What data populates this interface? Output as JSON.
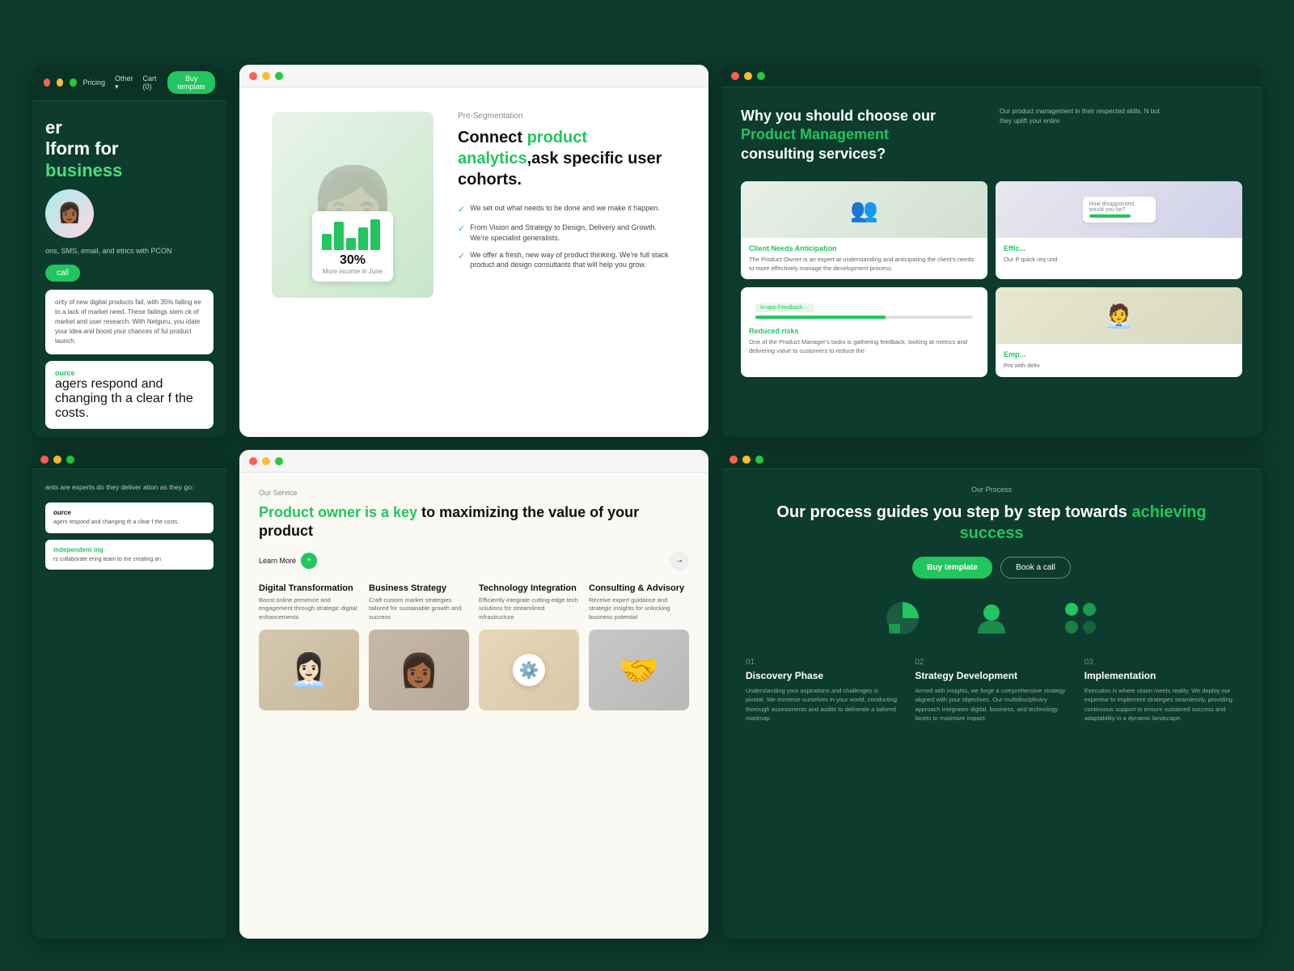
{
  "background": "#0d3b2e",
  "nav": {
    "pricing": "Pricing",
    "other": "Other",
    "other_arrow": "▾",
    "cart": "Cart (0)",
    "buy_btn": "Buy template"
  },
  "topleft": {
    "hero_line1": "er",
    "hero_line2": "lform for",
    "hero_green": "business",
    "sub_text": "ons, SMS, email, and\netrics with PCON",
    "call_btn": "call",
    "stat_text1": "ority of new digital products fail, with 35% falling\nee to a lack of market need. These failings stem\nck of market and user research. With Netguru, you\nidate your idea and boost your chances of\nful product launch.",
    "green_link1": "ource",
    "green_link2": "independent\ning",
    "stat_text2": "agers respond\nand changing\nth a clear\nf the costs.",
    "stat_text3": "rs collaborate\nering team to\nme creating an"
  },
  "topcenter": {
    "pre_seg": "Pre-Segmentation",
    "heading_start": "Connect ",
    "heading_green": "product analytics",
    "heading_end": ",ask specific user cohorts.",
    "chart_pct": "30%",
    "chart_label": "More income in June",
    "features": [
      "We set out what needs to be done and we make it happen.",
      "From Vision and Strategy to Design, Delivery and Growth. We're specialist generalists.",
      "We offer a fresh, new way of product thinking. We're full stack product and design consultants that will help you grow."
    ]
  },
  "topright": {
    "heading_start": "Why you should choose our ",
    "heading_green": "Product Management",
    "heading_end": " consulting services?",
    "sub_text": "Our product management\nin their respected skills. N\nbut they uplift your entire",
    "cards": [
      {
        "title": "Client Needs Anticipation",
        "desc": "The Product Owner is an expert at understanding and anticipating the client's needs to more effectively manage the development process.",
        "type": "light"
      },
      {
        "title": "Effic...",
        "desc": "Our P\nquick\nreq\nund",
        "type": "light"
      },
      {
        "title": "Reduced risks",
        "desc": "One of the Product Manager's tasks is gathering feedback, looking at metrics and delivering value to customers to reduce the",
        "type": "light",
        "tag": "In-app Feedback"
      },
      {
        "title": "Emp...",
        "desc": "Pro\nwith\ndeliv",
        "type": "light"
      }
    ]
  },
  "bottomleft": {
    "main_text": "ants are experts\ndo they deliver\nation as they go:",
    "mini_card1_title": "ource",
    "mini_card1_text": "agers respond\nand changing\nth a clear\nf the costs.",
    "green_link": "independent\ning",
    "mini_card2_text": "rs collaborate\nering team to\nme creating an"
  },
  "bottomcenter": {
    "service_label": "Our Service",
    "heading_start": "Product owner is a key ",
    "heading_end": "to maximizing the value of your product",
    "learn_more": "Learn More",
    "services": [
      {
        "title": "Digital Transformation",
        "desc": "Boost online presence and engagement through strategic digital enhancements"
      },
      {
        "title": "Business Strategy",
        "desc": "Craft custom market strategies tailored for sustainable growth and success"
      },
      {
        "title": "Technology Integration",
        "desc": "Efficiently integrate cutting-edge tech solutions for streamlined infrastructure"
      },
      {
        "title": "Consulting & Advisory",
        "desc": "Receive expert guidance and strategic insights for unlocking business potential"
      }
    ]
  },
  "bottomright": {
    "process_label": "Our Process",
    "heading_start": "Our process guides you step by step towards ",
    "heading_green": "achieving success",
    "buy_btn": "Buy template",
    "book_btn": "Book a call",
    "steps": [
      {
        "num": "01",
        "title": "Discovery Phase",
        "desc": "Understanding your aspirations and challenges is pivotal. We immerse ourselves in your world, conducting thorough assessments and audits to delineate a tailored roadmap."
      },
      {
        "num": "02",
        "title": "Strategy Development",
        "desc": "Armed with insights, we forge a comprehensive strategy aligned with your objectives. Our multidisciplinary approach integrates digital, business, and technology facets to maximize impact."
      },
      {
        "num": "03",
        "title": "Implementation",
        "desc": "Execution is where vision meets reality. We deploy our expertise to implement strategies seamlessly, providing continuous support to ensure sustained success and adaptability in a dynamic landscape."
      }
    ]
  }
}
